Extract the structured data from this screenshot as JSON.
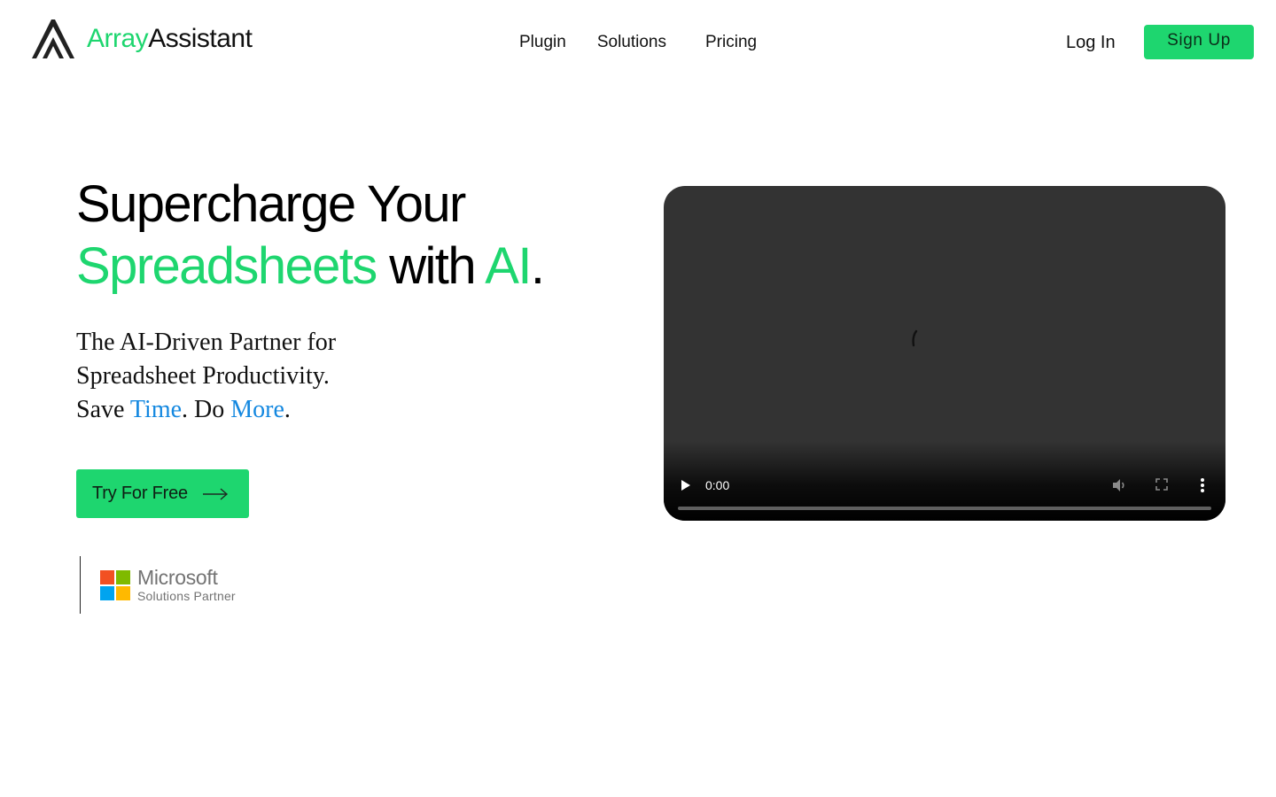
{
  "header": {
    "logo": {
      "icon": "array-assistant-logo-icon",
      "name_part1": "Array",
      "name_part2": "Assistant"
    },
    "nav": [
      {
        "label": "Plugin"
      },
      {
        "label": "Solutions"
      },
      {
        "label": "Pricing"
      }
    ],
    "login_label": "Log In",
    "signup_label": "Sign Up"
  },
  "hero": {
    "headline": {
      "line1": "Supercharge Your",
      "accent1": "Spreadsheets",
      "mid": " with ",
      "accent2": "AI",
      "end": "."
    },
    "subheadline": {
      "line1": "The AI-Driven Partner for",
      "line2": "Spreadsheet Productivity.",
      "line3_prefix": "Save ",
      "line3_word1": "Time",
      "line3_mid": ". Do ",
      "line3_word2": "More",
      "line3_end": "."
    },
    "cta_label": "Try For Free",
    "partner": {
      "brand": "Microsoft",
      "subtitle": "Solutions Partner",
      "icon": "microsoft-logo-icon"
    }
  },
  "video": {
    "time": "0:00",
    "progress": 0
  },
  "colors": {
    "brand_green": "#1ed66f",
    "accent_blue": "#1488e0",
    "video_bg": "#333333",
    "ms_red": "#f25022",
    "ms_green": "#7fba00",
    "ms_blue": "#00a4ef",
    "ms_yellow": "#ffb900"
  }
}
